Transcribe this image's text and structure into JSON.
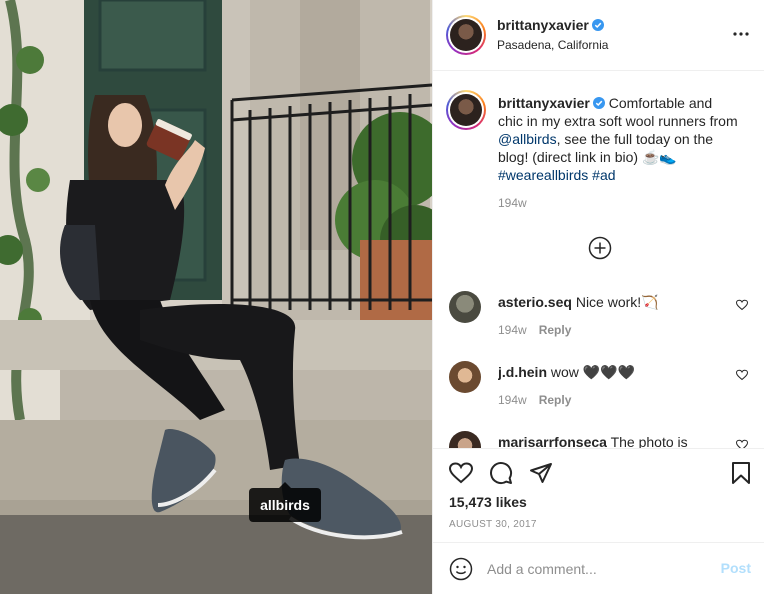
{
  "post": {
    "username": "brittanyxavier",
    "location": "Pasadena, California",
    "photo_tag": "allbirds",
    "caption": {
      "username": "brittanyxavier",
      "text_part1": " Comfortable and chic in my extra soft wool runners from ",
      "mention": "@allbirds",
      "text_part2": ", see the full today on the blog! (direct link in bio) ☕👟",
      "hashtag1": "#weareallbirds",
      "hashtag2": "#ad",
      "time": "194w"
    },
    "comments": [
      {
        "username": "asterio.seq",
        "text": " Nice work!🏹",
        "time": "194w",
        "reply": "Reply"
      },
      {
        "username": "j.d.hein",
        "text": " wow 🖤🖤🖤",
        "time": "194w",
        "reply": "Reply"
      },
      {
        "username": "marisarrfonseca",
        "text": " The photo is",
        "time": "",
        "reply": ""
      }
    ],
    "likes": "15,473 likes",
    "date": "AUGUST 30, 2017",
    "comment_placeholder": "Add a comment...",
    "post_label": "Post"
  },
  "colors": {
    "verified": "#3897f0",
    "link": "#00376b",
    "muted": "#8e8e8e",
    "post_disabled": "#b2dffc"
  },
  "icons": [
    "verified-badge-icon",
    "more-options-icon",
    "load-more-comments-icon",
    "heart-icon",
    "comment-icon",
    "share-icon",
    "bookmark-icon",
    "emoji-icon"
  ]
}
